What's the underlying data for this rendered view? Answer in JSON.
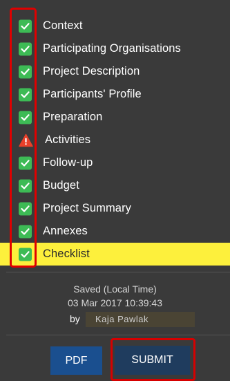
{
  "nav": {
    "items": [
      {
        "label": "Context",
        "status": "complete"
      },
      {
        "label": "Participating Organisations",
        "status": "complete"
      },
      {
        "label": "Project Description",
        "status": "complete"
      },
      {
        "label": "Participants' Profile",
        "status": "complete"
      },
      {
        "label": "Preparation",
        "status": "complete"
      },
      {
        "label": "Activities",
        "status": "warning"
      },
      {
        "label": "Follow-up",
        "status": "complete"
      },
      {
        "label": "Budget",
        "status": "complete"
      },
      {
        "label": "Project Summary",
        "status": "complete"
      },
      {
        "label": "Annexes",
        "status": "complete"
      },
      {
        "label": "Checklist",
        "status": "complete",
        "active": true
      }
    ]
  },
  "saved": {
    "heading": "Saved (Local Time)",
    "datetime": "03 Mar 2017 10:39:43",
    "by_label": "by",
    "user": "Kaja Pawlak"
  },
  "buttons": {
    "pdf": "PDF",
    "submit": "SUBMIT"
  },
  "colors": {
    "background": "#3a3a3a",
    "check_green": "#3dbb55",
    "warning_red": "#e8402a",
    "active_highlight": "#fdf03c",
    "annotation_red": "#e00000",
    "pdf_button": "#1a4f8f",
    "submit_button": "#1f3c5e"
  },
  "icons": {
    "complete": "check-square-icon",
    "warning": "warning-triangle-icon"
  }
}
